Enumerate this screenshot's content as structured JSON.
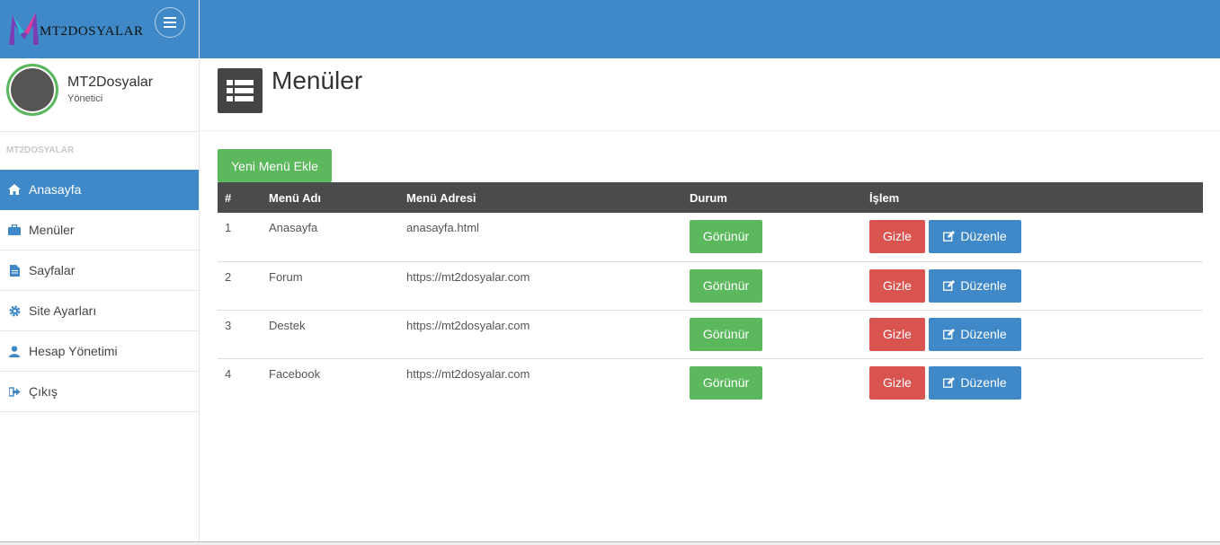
{
  "brand": {
    "logo_text": "MT2DOSYALAR"
  },
  "user": {
    "name": "MT2Dosyalar",
    "role": "Yönetici"
  },
  "sidebar": {
    "section_title": "MT2DOSYALAR",
    "items": [
      {
        "label": "Anasayfa",
        "icon": "home-icon",
        "active": true
      },
      {
        "label": "Menüler",
        "icon": "briefcase-icon",
        "active": false
      },
      {
        "label": "Sayfalar",
        "icon": "file-icon",
        "active": false
      },
      {
        "label": "Site Ayarları",
        "icon": "gear-icon",
        "active": false
      },
      {
        "label": "Hesap Yönetimi",
        "icon": "user-icon",
        "active": false
      },
      {
        "label": "Çıkış",
        "icon": "sign-out-icon",
        "active": false
      }
    ]
  },
  "page": {
    "title": "Menüler",
    "icon": "list-icon",
    "add_button": "Yeni Menü Ekle"
  },
  "table": {
    "headers": [
      "#",
      "Menü Adı",
      "Menü Adresi",
      "Durum",
      "İşlem"
    ],
    "rows": [
      {
        "id": "1",
        "name": "Anasayfa",
        "address": "anasayfa.html",
        "status": "Görünür",
        "hide": "Gizle",
        "edit": "Düzenle"
      },
      {
        "id": "2",
        "name": "Forum",
        "address": "https://mt2dosyalar.com",
        "status": "Görünür",
        "hide": "Gizle",
        "edit": "Düzenle"
      },
      {
        "id": "3",
        "name": "Destek",
        "address": "https://mt2dosyalar.com",
        "status": "Görünür",
        "hide": "Gizle",
        "edit": "Düzenle"
      },
      {
        "id": "4",
        "name": "Facebook",
        "address": "https://mt2dosyalar.com",
        "status": "Görünür",
        "hide": "Gizle",
        "edit": "Düzenle"
      }
    ]
  },
  "colors": {
    "primary": "#3f89c8",
    "success": "#5cb85c",
    "danger": "#d9534f",
    "table_header": "#4a4b4d"
  }
}
